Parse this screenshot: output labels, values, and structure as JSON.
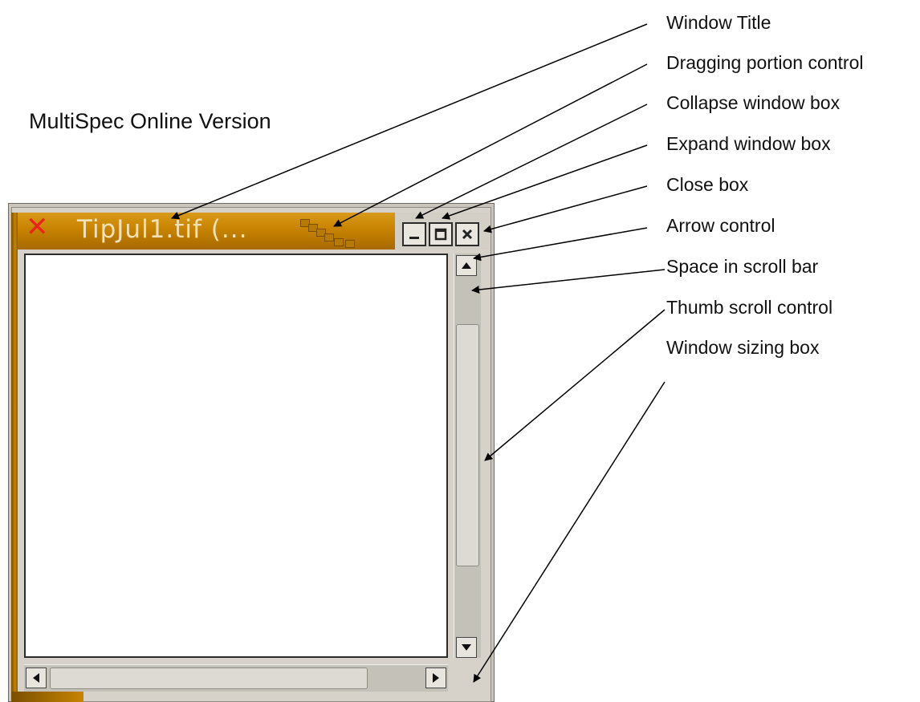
{
  "heading": "MultiSpec Online Version",
  "window": {
    "title": "TipJul1.tif (...",
    "close_glyph": "✕",
    "colors": {
      "titlebar": "#c78300",
      "title_text": "#f2e1b6",
      "close_glyph": "#e8251c",
      "frame": "#d6d2ca"
    }
  },
  "callouts": [
    "Window Title",
    "Dragging portion control",
    "Collapse window box",
    "Expand window box",
    "Close box",
    "Arrow control",
    "Space in scroll bar",
    "Thumb scroll control",
    "Window sizing box"
  ],
  "icons": {
    "collapse": "minimize-icon",
    "expand": "maximize-icon",
    "close": "close-icon",
    "arrow_up": "arrow-up-icon",
    "arrow_down": "arrow-down-icon",
    "arrow_left": "arrow-left-icon",
    "arrow_right": "arrow-right-icon"
  }
}
